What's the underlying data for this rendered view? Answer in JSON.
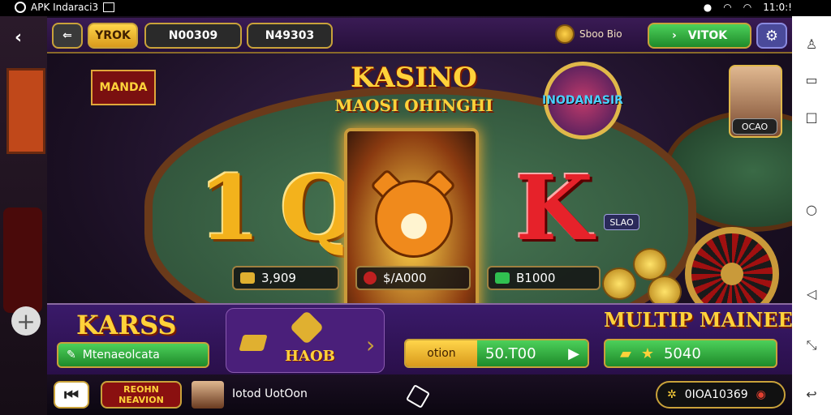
{
  "status_bar": {
    "app_label": "APK Indaraci3",
    "time": "11:0:!"
  },
  "toolbar": {
    "tab_1": "YROK",
    "tab_2": "N00309",
    "tab_3": "N49303",
    "shop_label": "Sboo Bio",
    "primary_button": "VITOK"
  },
  "game": {
    "title": "KASINO",
    "subtitle": "MAOSI OHINGHI",
    "badge": "INODANASIR",
    "side_sign": "MANDA",
    "reels": [
      "1",
      "Q",
      "K"
    ],
    "bets": [
      {
        "value": "3,909"
      },
      {
        "value": "$/A000"
      },
      {
        "value": "B1000"
      }
    ],
    "avatar_label": "OCAO",
    "stand_label": "SLAO"
  },
  "bottom_panel": {
    "left_title": "KARSS",
    "left_button": "Mtenaeolcata",
    "center_label": "HAOB",
    "deposit_label": "otion",
    "deposit_value": "50.T00",
    "right_title": "MULTIP MAINEEN",
    "right_value": "5040"
  },
  "bottom_bar": {
    "reon_label": "REOHN NEAVION",
    "user_name": "Iotod UotOon",
    "balance": "0IOA10369"
  }
}
